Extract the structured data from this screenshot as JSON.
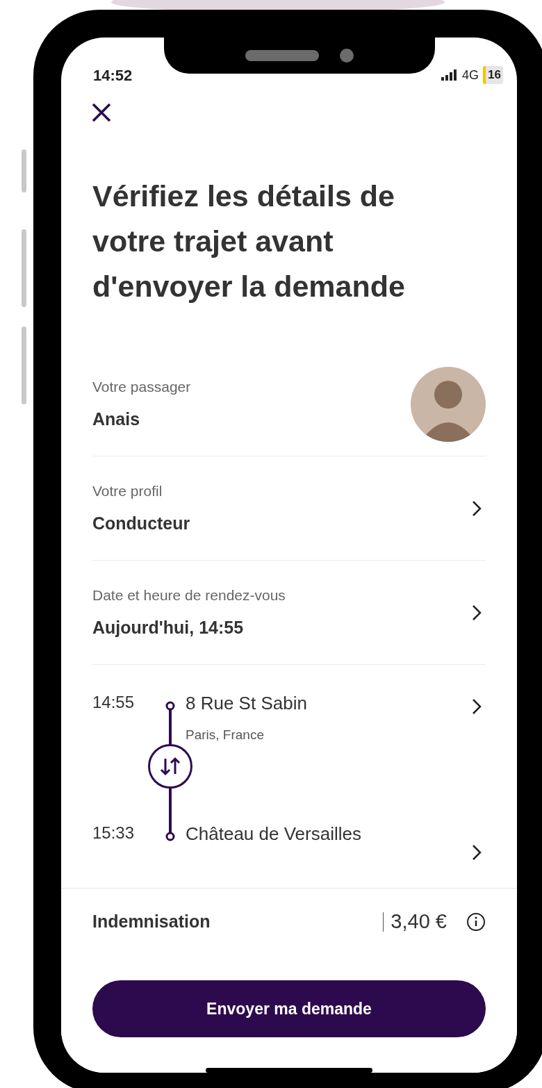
{
  "status_bar": {
    "time": "14:52",
    "network": "4G",
    "battery": "16"
  },
  "title": "Vérifiez les détails de votre trajet avant d'envoyer la demande",
  "details": [
    {
      "kind": "passenger",
      "label": "Votre passager",
      "value": "Anais"
    },
    {
      "kind": "link",
      "label": "Votre profil",
      "value": "Conducteur"
    },
    {
      "kind": "link",
      "label": "Date et heure de rendez-vous",
      "value": "Aujourd'hui, 14:55"
    }
  ],
  "route": [
    {
      "time": "14:55",
      "place": "8 Rue St Sabin",
      "detail": "Paris, France"
    },
    {
      "time": "15:33",
      "place": "Château de Versailles"
    }
  ],
  "compensation": {
    "label": "Indemnisation",
    "amount": "3,40 €"
  },
  "submit_button": "Envoyer ma demande"
}
